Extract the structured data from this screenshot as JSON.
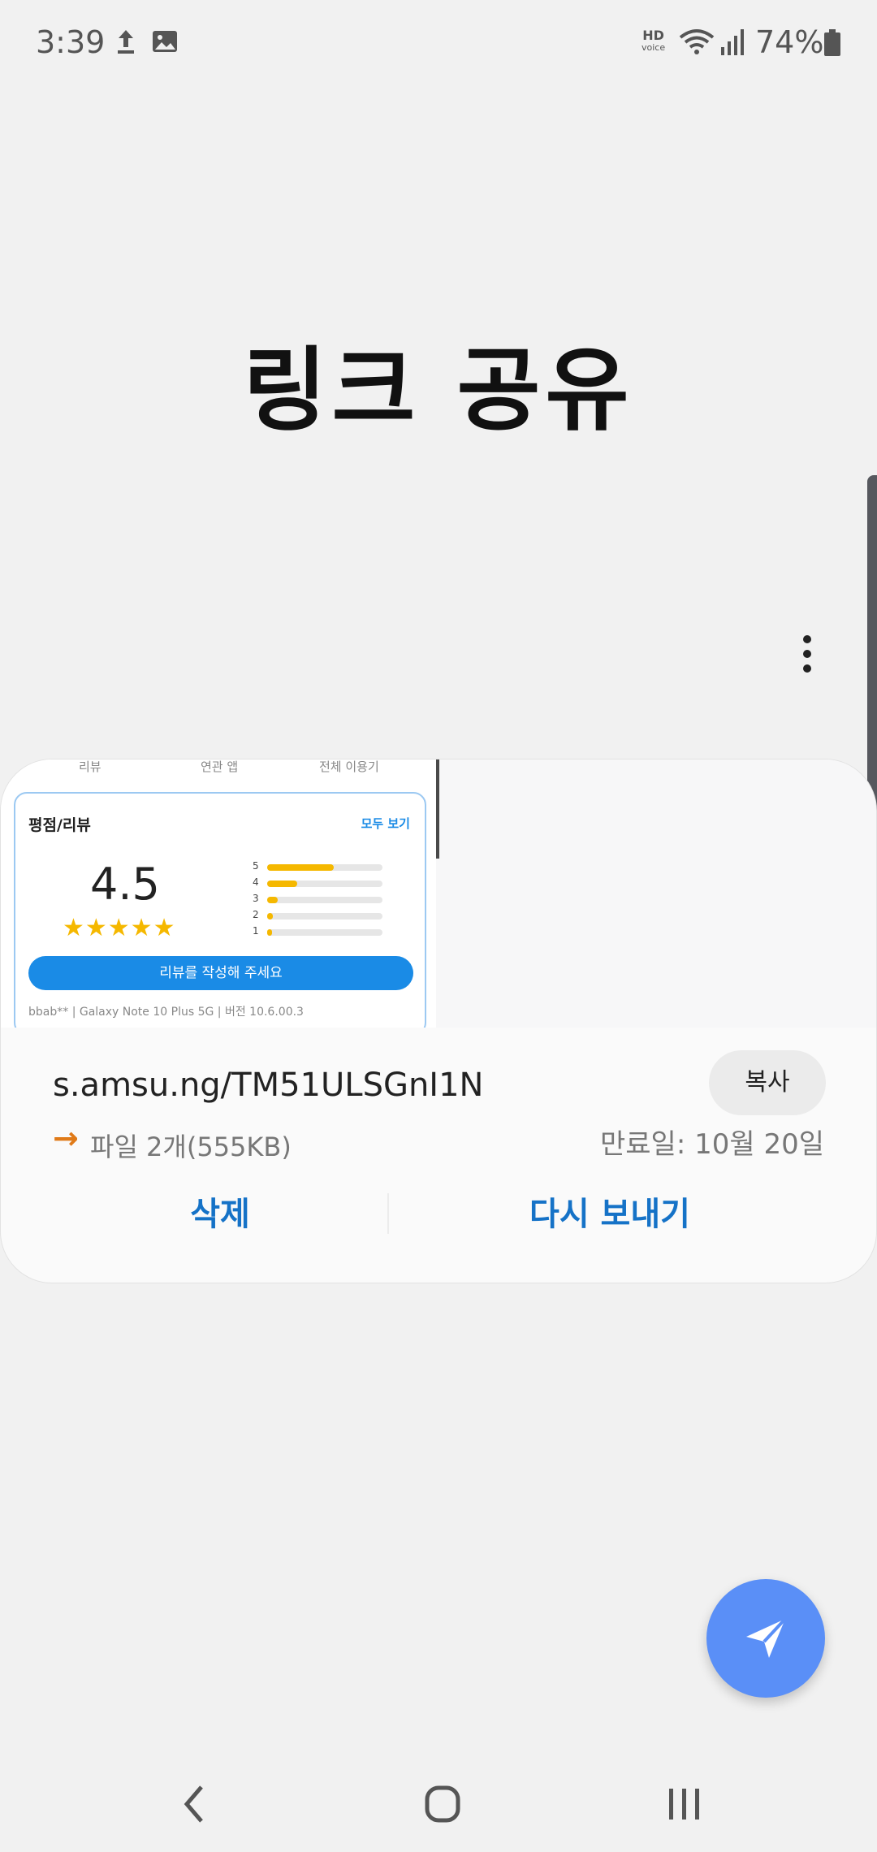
{
  "status_bar": {
    "time": "3:39",
    "hd_voice": "HD",
    "hd_voice_sub": "voice",
    "battery_percent": "74%",
    "icons": [
      "upload-icon",
      "image-icon",
      "hd-voice-icon",
      "wifi-icon",
      "signal-icon",
      "battery-icon"
    ]
  },
  "page": {
    "title": "링크 공유",
    "more_icon": "more-vertical-icon"
  },
  "card": {
    "preview": {
      "tabs": [
        "리뷰",
        "연관 앱",
        "전체 이용기"
      ],
      "rating_title": "평점/리뷰",
      "rating_more": "모두 보기",
      "score": "4.5",
      "stars": "★★★★★",
      "star_fraction": 0.9,
      "bars": [
        {
          "label": "5",
          "fraction": 0.58
        },
        {
          "label": "4",
          "fraction": 0.26
        },
        {
          "label": "3",
          "fraction": 0.09
        },
        {
          "label": "2",
          "fraction": 0.05
        },
        {
          "label": "1",
          "fraction": 0.04
        }
      ],
      "write_review": "리뷰를 작성해 주세요",
      "review_meta": "bbab**  |  Galaxy Note 10 Plus 5G  |  버전 10.6.00.3"
    },
    "link_url": "s.amsu.ng/TM51ULSGnI1N",
    "copy_label": "복사",
    "file_arrow": "→",
    "file_info": "파일 2개(555KB)",
    "expiry": "만료일: 10월 20일",
    "delete_label": "삭제",
    "resend_label": "다시 보내기"
  },
  "fab": {
    "icon": "send-icon"
  },
  "nav": {
    "back_icon": "back-icon",
    "home_icon": "home-icon",
    "recents_icon": "recents-icon"
  },
  "colors": {
    "background": "#f1f1f1",
    "card": "#fafafa",
    "accent_blue": "#1572c7",
    "fab": "#5a8ff7",
    "arrow_orange": "#e07a18",
    "star_yellow": "#f5b800"
  }
}
